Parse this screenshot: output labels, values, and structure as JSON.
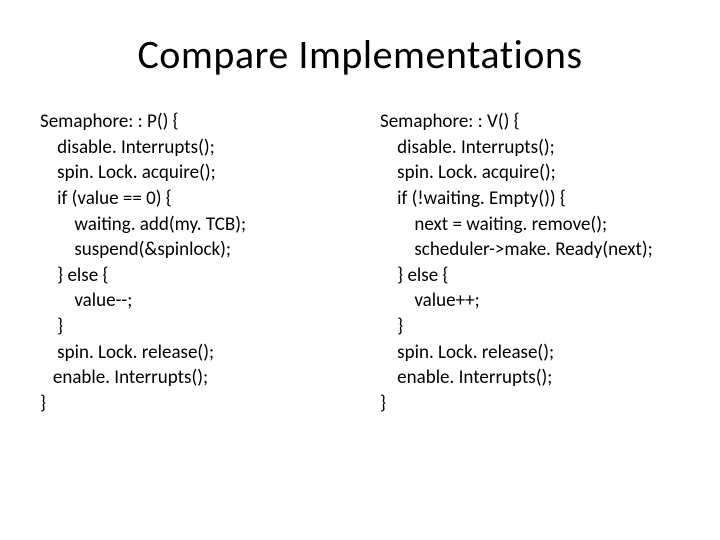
{
  "title": "Compare Implementations",
  "left": {
    "l0": "Semaphore: : P() {",
    "l1": "    disable. Interrupts();",
    "l2": "    spin. Lock. acquire();",
    "l3": "    if (value == 0) {",
    "l4": "        waiting. add(my. TCB);",
    "l5": "        suspend(&spinlock);",
    "l6": "    } else {",
    "l7": "        value--;",
    "l8": "    }",
    "l9": "    spin. Lock. release();",
    "l10": "   enable. Interrupts();",
    "l11": "}"
  },
  "right": {
    "l0": "Semaphore: : V() {",
    "l1": "    disable. Interrupts();",
    "l2": "    spin. Lock. acquire();",
    "l3": "    if (!waiting. Empty()) {",
    "l4": "        next = waiting. remove();",
    "l5": "        scheduler->make. Ready(next);",
    "l6": "    } else {",
    "l7": "        value++;",
    "l8": "    }",
    "l9": "    spin. Lock. release();",
    "l10": "    enable. Interrupts();",
    "l11": "}"
  }
}
